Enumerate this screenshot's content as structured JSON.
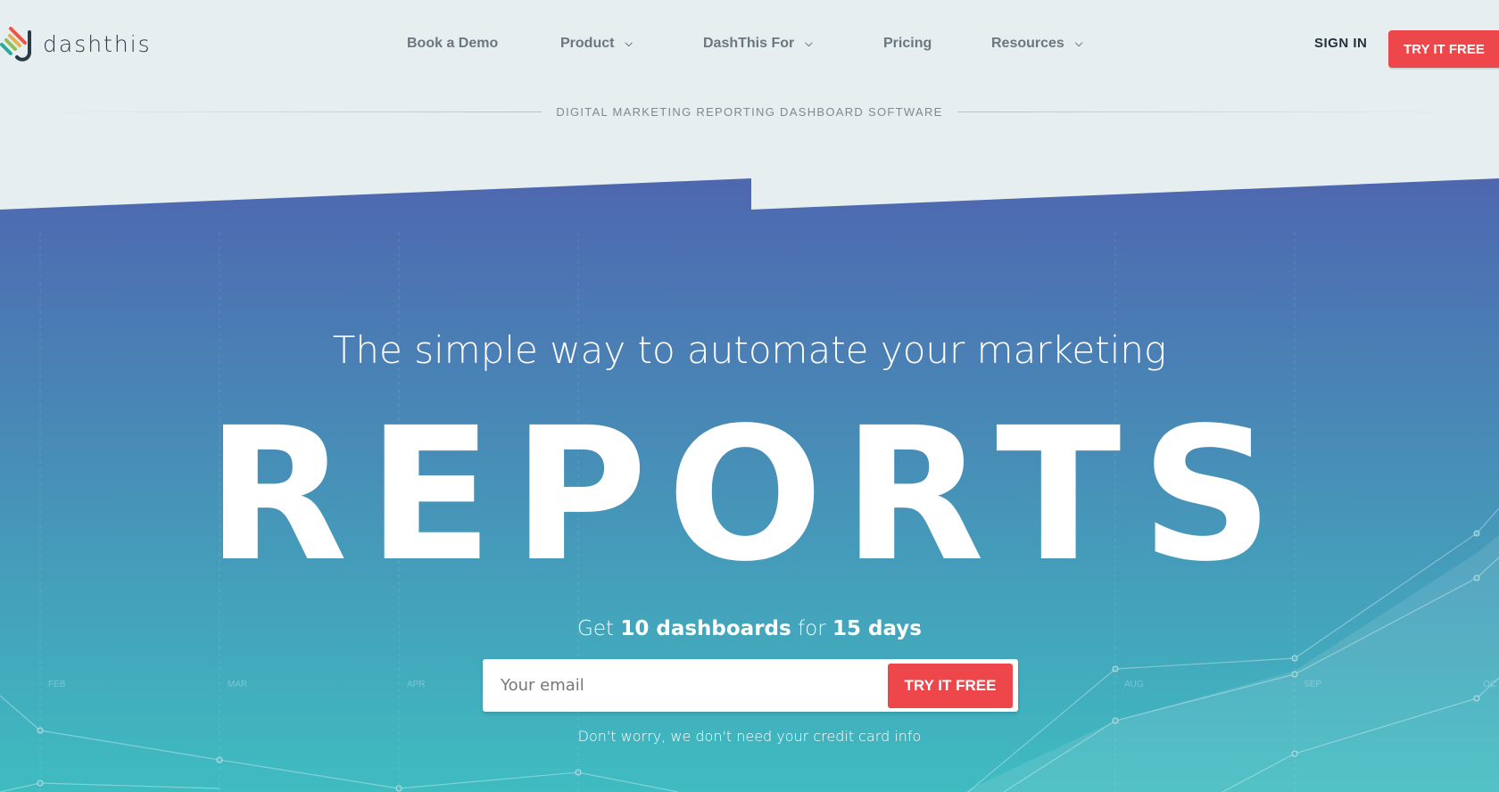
{
  "nav": {
    "logo_text": "dashthis",
    "items": [
      {
        "label": "Book a Demo",
        "dropdown": false
      },
      {
        "label": "Product",
        "dropdown": true
      },
      {
        "label": "DashThis For",
        "dropdown": true
      },
      {
        "label": "Pricing",
        "dropdown": false
      },
      {
        "label": "Resources",
        "dropdown": true
      }
    ],
    "sign_in": "SIGN IN",
    "try_free": "TRY IT FREE"
  },
  "tagline": "DIGITAL MARKETING REPORTING DASHBOARD SOFTWARE",
  "hero": {
    "headline": "The simple way to automate your marketing",
    "big_word": "REPORTS",
    "sub_pre": "Get ",
    "sub_b1": "10 dashboards",
    "sub_mid": " for ",
    "sub_b2": "15 days",
    "email_placeholder": "Your email",
    "cta": "TRY IT FREE",
    "note": "Don't worry, we don't need your credit card info",
    "chart_months": [
      "FEB",
      "MAR",
      "APR",
      "AUG",
      "SEP",
      "OC"
    ]
  },
  "colors": {
    "accent": "#ed474b",
    "gradient_top": "#4e67b0",
    "gradient_bottom": "#3fbcc0",
    "bg": "#e6eef0"
  }
}
